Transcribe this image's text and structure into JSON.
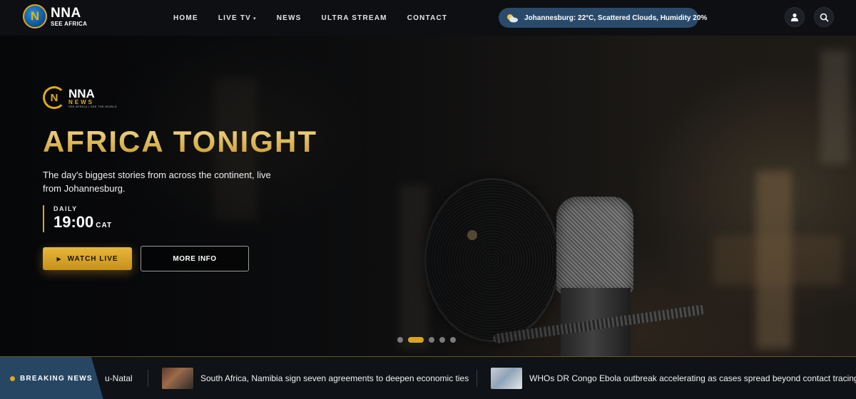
{
  "header": {
    "logo": {
      "badge": "N",
      "main": "NNA",
      "sub": "SEE AFRICA"
    },
    "nav": [
      {
        "label": "HOME"
      },
      {
        "label": "LIVE TV",
        "caret": "▾"
      },
      {
        "label": "NEWS"
      },
      {
        "label": "ULTRA STREAM"
      },
      {
        "label": "CONTACT"
      }
    ],
    "weather": {
      "icon": "partly-cloudy-icon",
      "text": "Johannesburg: 22°C, Scattered Clouds, Humidity 20%"
    },
    "actions": [
      {
        "icon": "user-icon"
      },
      {
        "icon": "search-icon"
      }
    ]
  },
  "hero": {
    "brand": {
      "mark": "N",
      "main": "NNA",
      "news": "NEWS",
      "tagline": "SEE AFRICA • SEE THE WORLD"
    },
    "title": "AFRICA TONIGHT",
    "description": "The day's biggest stories from across the continent, live from Johannesburg.",
    "schedule": {
      "label": "DAILY",
      "time": "19:00",
      "timezone": "CAT"
    },
    "watch_button": "WATCH LIVE",
    "info_button": "MORE INFO",
    "slides": {
      "count": 5,
      "active": 2
    }
  },
  "ticker": {
    "label": "BREAKING NEWS",
    "items": [
      {
        "text": "u-Natal"
      },
      {
        "text": "South Africa, Namibia sign seven agreements to deepen economic ties"
      },
      {
        "text": "WHO\u0001s DR Congo Ebola outbreak accelerating as cases spread beyond contact tracing"
      }
    ]
  },
  "colors": {
    "accent": "#d9a521",
    "nav_bg": "#0d0f13",
    "weather_bg": "#2a4a6b",
    "ticker_label_bg": "#274664"
  }
}
